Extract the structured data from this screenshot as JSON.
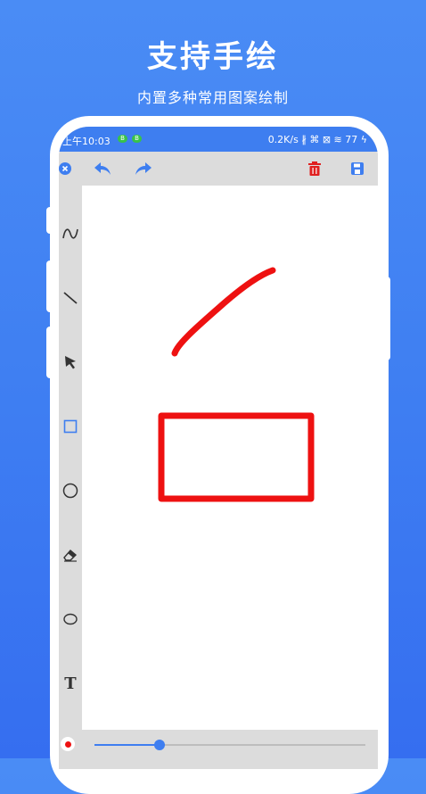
{
  "promo": {
    "title": "支持手绘",
    "subtitle": "内置多种常用图案绘制"
  },
  "status_bar": {
    "time": "上午10:03",
    "pill_1": "B",
    "pill_2": "B",
    "right_text": "0.2K/s ∦ ⌘ ⊠ ≋ 77 ϟ",
    "battery": "77"
  },
  "toolbar": {
    "close_icon": "close-circle-icon",
    "undo_icon": "undo-icon",
    "redo_icon": "redo-icon",
    "delete_icon": "trash-icon",
    "save_icon": "save-icon"
  },
  "tools": [
    {
      "name": "freehand",
      "icon": "wave-icon"
    },
    {
      "name": "line",
      "icon": "line-icon"
    },
    {
      "name": "arrow",
      "icon": "arrow-icon"
    },
    {
      "name": "rectangle",
      "icon": "rectangle-icon"
    },
    {
      "name": "circle",
      "icon": "circle-icon"
    },
    {
      "name": "eraser",
      "icon": "eraser-icon"
    },
    {
      "name": "ellipse",
      "icon": "ellipse-icon"
    },
    {
      "name": "text",
      "icon": "text-icon",
      "glyph": "T"
    }
  ],
  "brush": {
    "color": "#ee1111",
    "size_fraction": 0.24
  },
  "colors": {
    "accent": "#3e7ef0",
    "stroke": "#ee1111"
  }
}
